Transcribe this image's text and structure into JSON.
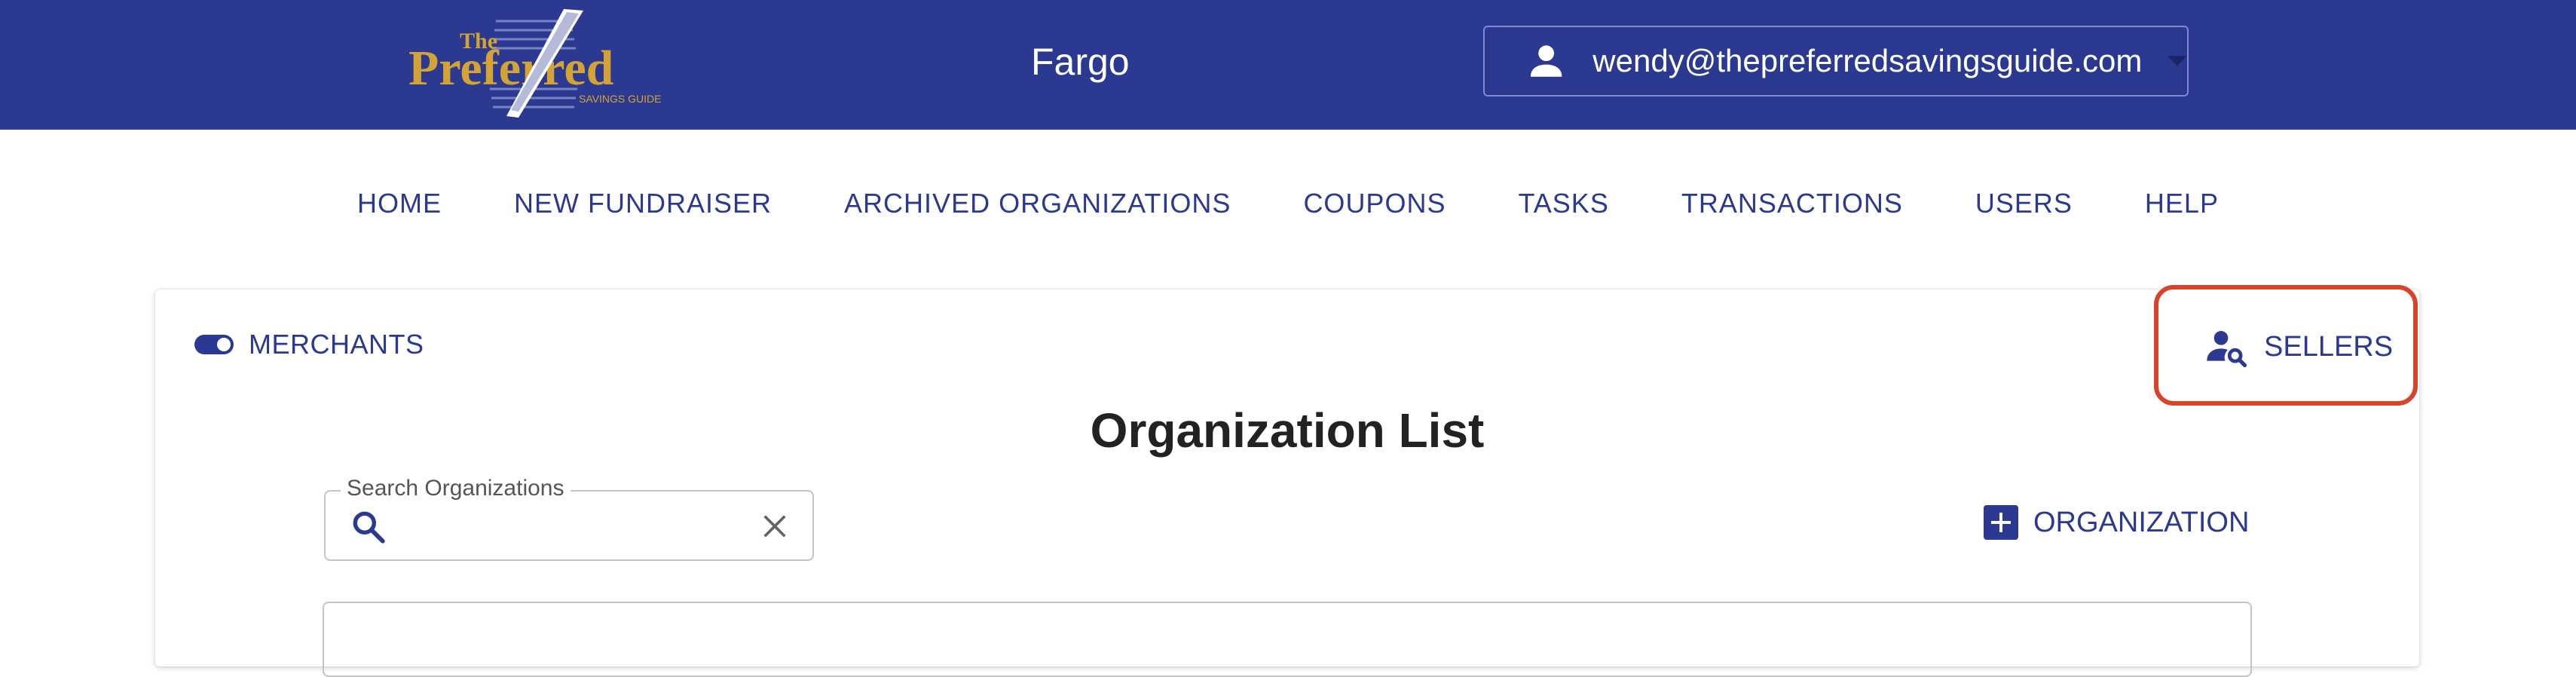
{
  "header": {
    "logo": {
      "line1": "The",
      "line2": "Preferred",
      "line3": "SAVINGS GUIDE"
    },
    "region": "Fargo",
    "user_email": "wendy@thepreferredsavingsguide.com"
  },
  "nav": {
    "items": [
      {
        "label": "HOME"
      },
      {
        "label": "NEW FUNDRAISER"
      },
      {
        "label": "ARCHIVED ORGANIZATIONS"
      },
      {
        "label": "COUPONS"
      },
      {
        "label": "TASKS"
      },
      {
        "label": "TRANSACTIONS"
      },
      {
        "label": "USERS"
      },
      {
        "label": "HELP"
      }
    ]
  },
  "card": {
    "toggle_label": "MERCHANTS",
    "sellers_label": "SELLERS",
    "title": "Organization List",
    "search": {
      "label": "Search Organizations",
      "value": ""
    },
    "add_org_label": "ORGANIZATION"
  },
  "colors": {
    "brand": "#2b3990",
    "logo_gold": "#d4a336",
    "highlight": "#d8432b"
  },
  "icons": {
    "user": "person-icon",
    "caret": "caret-down-icon",
    "sellers": "person-search-icon",
    "search": "search-icon",
    "clear": "close-icon",
    "add": "add-box-icon"
  }
}
